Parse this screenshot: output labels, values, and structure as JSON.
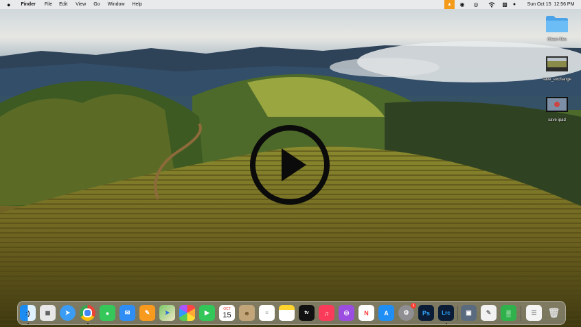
{
  "menubar": {
    "apple_icon": "apple-icon",
    "app_name": "Finder",
    "menus": [
      "File",
      "Edit",
      "View",
      "Go",
      "Window",
      "Help"
    ],
    "datetime": "Sun Oct 15  12:56 PM"
  },
  "desktop": {
    "icons": [
      {
        "label": "Clean files"
      },
      {
        "label": "save_exchange"
      },
      {
        "label": "save ipad"
      }
    ]
  },
  "video": {
    "play_icon": "play-icon"
  },
  "dock": {
    "calendar": {
      "month": "OCT",
      "day": "15"
    },
    "appletv_label": "tv",
    "photoshop_label": "Ps",
    "lightroom_label": "Lrc",
    "settings_badge": "1",
    "colors": {
      "accent": "#0a84ff",
      "dock_bg": "#bebebe"
    }
  }
}
